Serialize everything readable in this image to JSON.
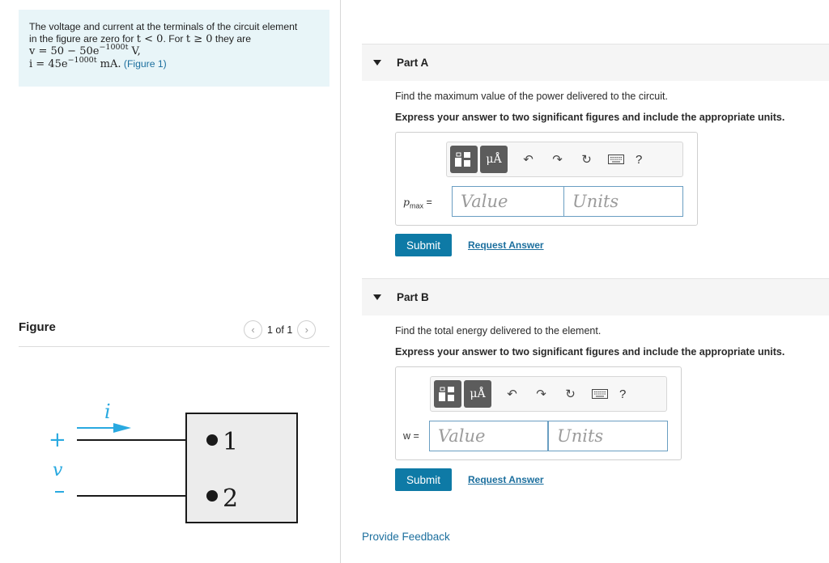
{
  "problem": {
    "line1": "The voltage and current at the terminals of the circuit element",
    "line2_a": "in the figure are zero for ",
    "line2_math1": "t < 0",
    "line2_b": ". For ",
    "line2_math2": "t ≥ 0",
    "line2_c": " they are",
    "v_expr": "v = 50 − 50e",
    "v_exp": "−1000t",
    "v_unit": " V,",
    "i_expr": "i = 45e",
    "i_exp": "−1000t",
    "i_unit": " mA.",
    "figure_link": "(Figure 1)"
  },
  "figure": {
    "title": "Figure",
    "pager": "1 of 1",
    "current_label": "i",
    "plus": "+",
    "voltage_label": "v",
    "minus": "−",
    "terminal1": "1",
    "terminal2": "2"
  },
  "partA": {
    "label": "Part A",
    "question": "Find the maximum value of the power delivered to the circuit.",
    "instruction": "Express your answer to two significant figures and include the appropriate units.",
    "var_label": "pmax =",
    "var_main": "p",
    "var_sub": "max",
    "value_placeholder": "Value",
    "units_placeholder": "Units",
    "submit": "Submit",
    "request": "Request Answer"
  },
  "partB": {
    "label": "Part B",
    "question": "Find the total energy delivered to the element.",
    "instruction": "Express your answer to two significant figures and include the appropriate units.",
    "var_label": "w =",
    "value_placeholder": "Value",
    "units_placeholder": "Units",
    "submit": "Submit",
    "request": "Request Answer"
  },
  "toolbar": {
    "units_btn": "μÅ",
    "help": "?",
    "icons": [
      "templates-icon",
      "units-icon",
      "undo-icon",
      "redo-icon",
      "reset-icon",
      "keyboard-icon",
      "help-icon"
    ]
  },
  "feedback": "Provide Feedback",
  "colors": {
    "accent": "#0e7aa6",
    "link": "#1c6f9e",
    "problem_bg": "#e8f5f8",
    "figure_blue": "#29a9e0"
  }
}
